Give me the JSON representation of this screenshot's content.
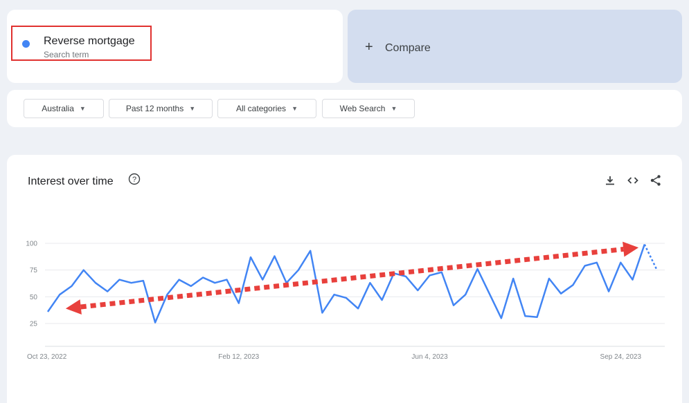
{
  "term": {
    "name": "Reverse mortgage",
    "subtitle": "Search term",
    "color": "#4285f4"
  },
  "compare": {
    "plus": "+",
    "label": "Compare"
  },
  "filters": [
    {
      "label": "Australia"
    },
    {
      "label": "Past 12 months"
    },
    {
      "label": "All categories"
    },
    {
      "label": "Web Search"
    }
  ],
  "chart_header": {
    "title": "Interest over time",
    "help_icon": "help-circle-icon",
    "actions": [
      "download-icon",
      "embed-code-icon",
      "share-icon"
    ]
  },
  "chart_data": {
    "type": "line",
    "title": "Interest over time",
    "xlabel": "",
    "ylabel": "",
    "ylim": [
      0,
      100
    ],
    "y_ticks": [
      25,
      50,
      75,
      100
    ],
    "x_tick_labels": [
      {
        "label": "Oct 23, 2022",
        "index": 0
      },
      {
        "label": "Feb 12, 2023",
        "index": 16
      },
      {
        "label": "Jun 4, 2023",
        "index": 32
      },
      {
        "label": "Sep 24, 2023",
        "index": 48
      }
    ],
    "grid": true,
    "series": [
      {
        "color": "#4285f4",
        "values": [
          36,
          52,
          60,
          75,
          63,
          55,
          66,
          63,
          65,
          26,
          52,
          66,
          60,
          68,
          63,
          66,
          44,
          87,
          66,
          88,
          63,
          75,
          93,
          35,
          52,
          49,
          39,
          63,
          47,
          72,
          69,
          56,
          70,
          73,
          42,
          52,
          76,
          53,
          30,
          67,
          32,
          31,
          67,
          53,
          61,
          79,
          82,
          55,
          82,
          66,
          99,
          76
        ],
        "partial_last_point": true
      }
    ],
    "annotation": {
      "type": "dashed-trend-arrow",
      "color": "#e8403c",
      "start_index": 1.5,
      "start_value": 39,
      "end_index": 49.5,
      "end_value": 96
    }
  }
}
